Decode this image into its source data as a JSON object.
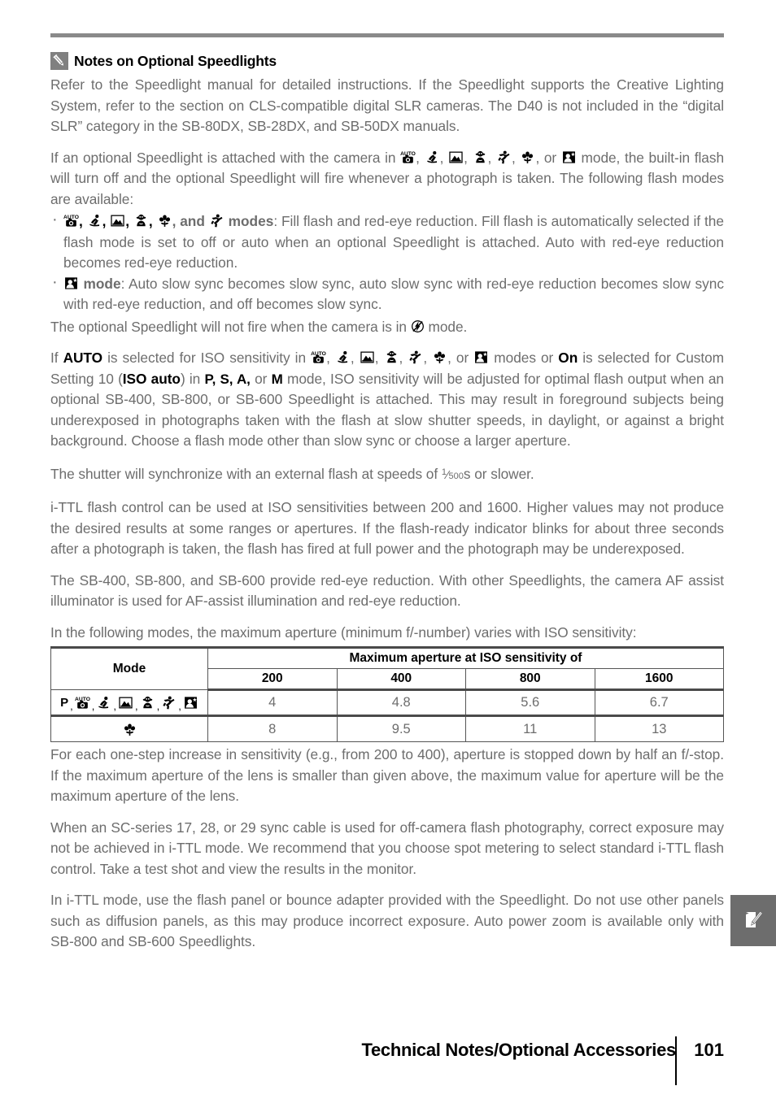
{
  "page": {
    "number": "101",
    "footer_title": "Technical Notes/Optional Accessories"
  },
  "note": {
    "icon": "pencil-note-icon",
    "title": "Notes on Optional Speedlights",
    "paragraph_1": "Refer to the Speedlight manual for detailed instructions.  If the Speedlight supports the Creative Lighting System, refer to the section on CLS-compatible digital SLR cameras.  The D40 is not included in the “digital SLR” category in the SB-80DX, SB-28DX, and SB-50DX manuals.",
    "paragraph_2_before_icons": "If an optional Speedlight is attached with the camera in ",
    "paragraph_2_mid": ", or ",
    "paragraph_2_after_icons": " mode, the built-in flash will turn off and the optional Speedlight will fire whenever a photograph is taken.  The following flash modes are available:",
    "bullet_1_bold_and": ", and ",
    "bullet_1_bold_modes": " modes",
    "bullet_1_text": ": Fill flash and red-eye reduction.  Fill flash is automatically selected if the flash mode is set to off or auto when an optional Speedlight is attached.  Auto with red-eye reduction becomes red-eye reduction.",
    "bullet_2_bold_mode": "mode",
    "bullet_2_text": ": Auto slow sync becomes slow sync, auto slow sync with red-eye reduction becomes slow sync with red-eye reduction, and off becomes slow sync.",
    "after_bullets_before_icon": "The optional Speedlight will not fire when the camera is in ",
    "after_bullets_after_icon": " mode.",
    "paragraph_3_a": "If ",
    "paragraph_3_auto": "AUTO",
    "paragraph_3_b": " is selected for ISO sensitivity in ",
    "paragraph_3_c": ", or ",
    "paragraph_3_d": " modes or ",
    "paragraph_3_on": "On",
    "paragraph_3_e": " is selected for Custom Setting 10 (",
    "paragraph_3_isoauto": "ISO auto",
    "paragraph_3_f": ") in ",
    "paragraph_3_psam": "P, S, A,",
    "paragraph_3_g": " or ",
    "paragraph_3_m": "M",
    "paragraph_3_h": " mode, ISO sensitivity will be adjusted for optimal flash output when an optional SB-400, SB-800, or SB-600 Speedlight is attached.  This may result in foreground subjects being underexposed in photographs taken with the flash at slow shutter speeds, in daylight, or against a bright background.  Choose a flash mode other than slow sync or choose a larger aperture.",
    "paragraph_4_a": "The shutter will synchronize with an external flash at speeds of ",
    "paragraph_4_frac_num": "1",
    "paragraph_4_frac_den": "500",
    "paragraph_4_unit": "s",
    "paragraph_4_b": " or slower.",
    "paragraph_5": "i-TTL flash control can be used at ISO sensitivities between 200 and 1600.  Higher values may not produce the desired results at some ranges or apertures.  If the flash-ready indicator blinks for about three seconds after a photograph is taken, the flash has fired at full power and the photograph may be underexposed.",
    "paragraph_6": "The SB-400, SB-800, and SB-600 provide red-eye reduction.  With other Speedlights, the camera AF assist illuminator is used for AF-assist illumination and red-eye reduction.",
    "paragraph_7": "In the following modes, the maximum aperture (minimum f/-number) varies with ISO sensitivity:",
    "paragraph_8": "For each one-step increase in sensitivity (e.g., from 200 to 400), aperture is stopped down by half an f/-stop.  If the maximum aperture of the lens is smaller than given above, the maximum value for aperture will be the maximum aperture of the lens.",
    "paragraph_9": "When an SC-series 17, 28, or 29 sync cable is used for off-camera flash photography, correct exposure may not be achieved in i-TTL mode.  We recommend that you choose spot metering to select standard i-TTL flash control.  Take a test shot and view the results in the monitor.",
    "paragraph_10": "In i-TTL mode, use the flash panel or bounce adapter provided with the Speedlight.  Do not use other panels such as diffusion panels, as this may produce incorrect exposure.  Auto power zoom is available only with SB-800 and SB-600 Speedlights."
  },
  "icons": {
    "auto": "auto-camera-mode-icon",
    "portrait": "portrait-mode-icon",
    "landscape": "landscape-mode-icon",
    "child": "child-mode-icon",
    "sports": "sports-mode-icon",
    "closeup": "close-up-mode-icon",
    "night_portrait": "night-portrait-mode-icon",
    "flash_off": "flash-off-icon",
    "program": "P"
  },
  "table": {
    "col_mode_header": "Mode",
    "span_header": "Maximum aperture at ISO sensitivity of",
    "iso_headers": [
      "200",
      "400",
      "800",
      "1600"
    ],
    "rows": [
      {
        "mode_icons": [
          "P",
          "auto",
          "portrait",
          "landscape",
          "child",
          "sports",
          "night_portrait"
        ],
        "values": [
          "4",
          "4.8",
          "5.6",
          "6.7"
        ]
      },
      {
        "mode_icons": [
          "closeup"
        ],
        "values": [
          "8",
          "9.5",
          "11",
          "13"
        ]
      }
    ]
  },
  "side_tab": {
    "icon": "note-pencil-tab-icon"
  }
}
